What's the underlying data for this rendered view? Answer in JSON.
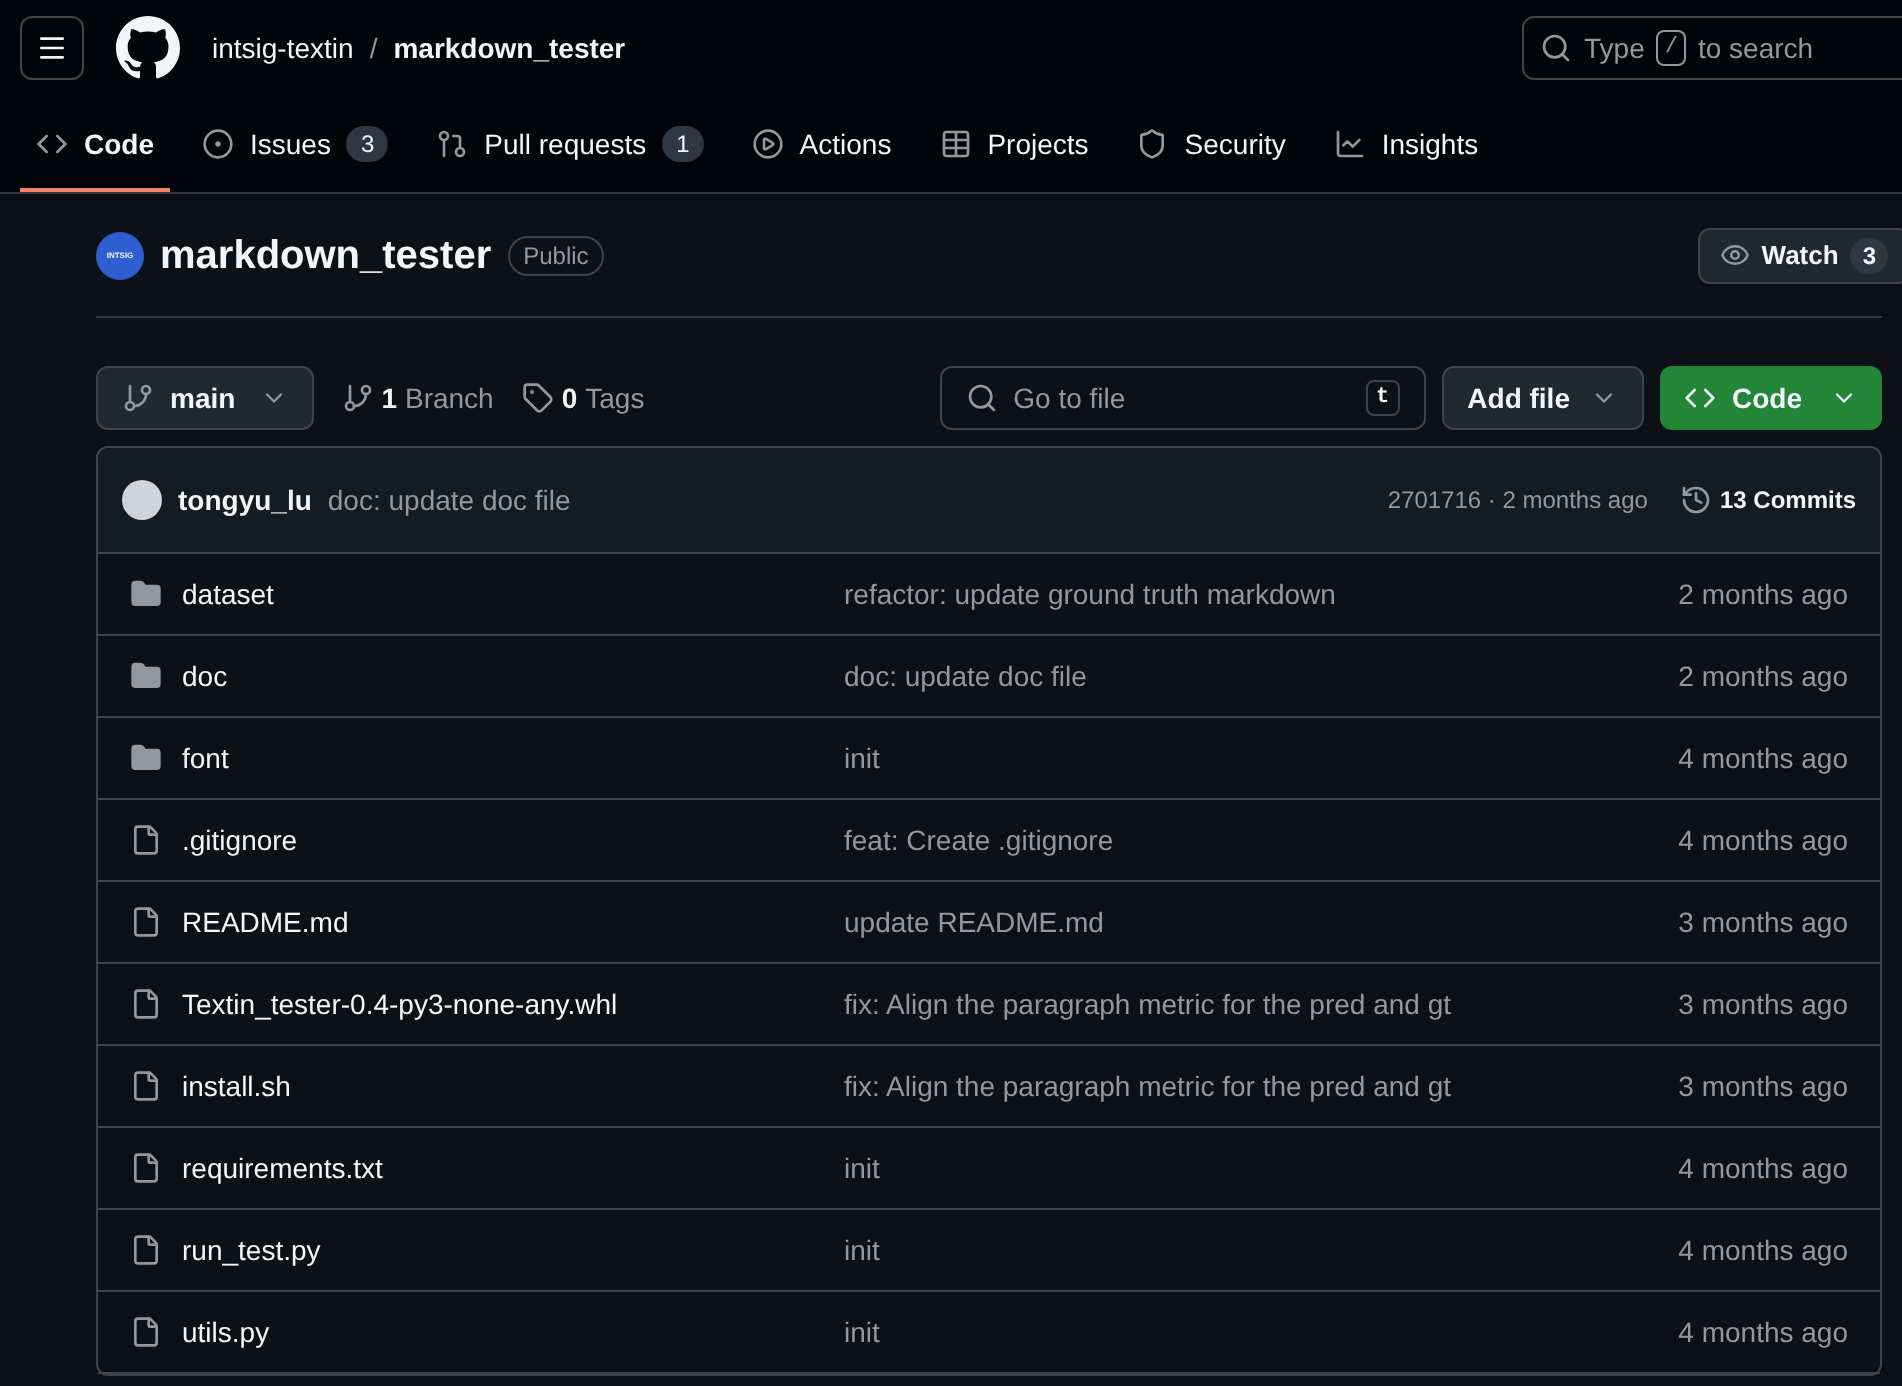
{
  "header": {
    "owner": "intsig-textin",
    "separator": "/",
    "repo": "markdown_tester",
    "search": {
      "before": "Type",
      "key": "/",
      "after": "to search"
    }
  },
  "tabs": [
    {
      "label": "Code",
      "selected": true
    },
    {
      "label": "Issues",
      "count": "3",
      "selected": false
    },
    {
      "label": "Pull requests",
      "count": "1",
      "selected": false
    },
    {
      "label": "Actions",
      "selected": false
    },
    {
      "label": "Projects",
      "selected": false
    },
    {
      "label": "Security",
      "selected": false
    },
    {
      "label": "Insights",
      "selected": false
    }
  ],
  "repo": {
    "avatar_text": "INTSIG",
    "name": "markdown_tester",
    "visibility": "Public",
    "watch": {
      "label": "Watch",
      "count": "3"
    }
  },
  "toolbar": {
    "branch": "main",
    "branches": {
      "count": "1",
      "label": "Branch"
    },
    "tags": {
      "count": "0",
      "label": "Tags"
    },
    "go_to_file": {
      "placeholder": "Go to file",
      "key": "t"
    },
    "add_file": "Add file",
    "code": "Code"
  },
  "last_commit": {
    "author": "tongyu_lu",
    "message": "doc: update doc file",
    "hash_time": "2701716 · 2 months ago",
    "commits": "13 Commits"
  },
  "files": [
    {
      "kind": "folder",
      "name": "dataset",
      "message": "refactor: update ground truth markdown",
      "time": "2 months ago"
    },
    {
      "kind": "folder",
      "name": "doc",
      "message": "doc: update doc file",
      "time": "2 months ago"
    },
    {
      "kind": "folder",
      "name": "font",
      "message": "init",
      "time": "4 months ago"
    },
    {
      "kind": "file",
      "name": ".gitignore",
      "message": "feat: Create .gitignore",
      "time": "4 months ago"
    },
    {
      "kind": "file",
      "name": "README.md",
      "message": "update README.md",
      "time": "3 months ago"
    },
    {
      "kind": "file",
      "name": "Textin_tester-0.4-py3-none-any.whl",
      "message": "fix: Align the paragraph metric for the pred and gt",
      "time": "3 months ago"
    },
    {
      "kind": "file",
      "name": "install.sh",
      "message": "fix: Align the paragraph metric for the pred and gt",
      "time": "3 months ago"
    },
    {
      "kind": "file",
      "name": "requirements.txt",
      "message": "init",
      "time": "4 months ago"
    },
    {
      "kind": "file",
      "name": "run_test.py",
      "message": "init",
      "time": "4 months ago"
    },
    {
      "kind": "file",
      "name": "utils.py",
      "message": "init",
      "time": "4 months ago"
    }
  ]
}
